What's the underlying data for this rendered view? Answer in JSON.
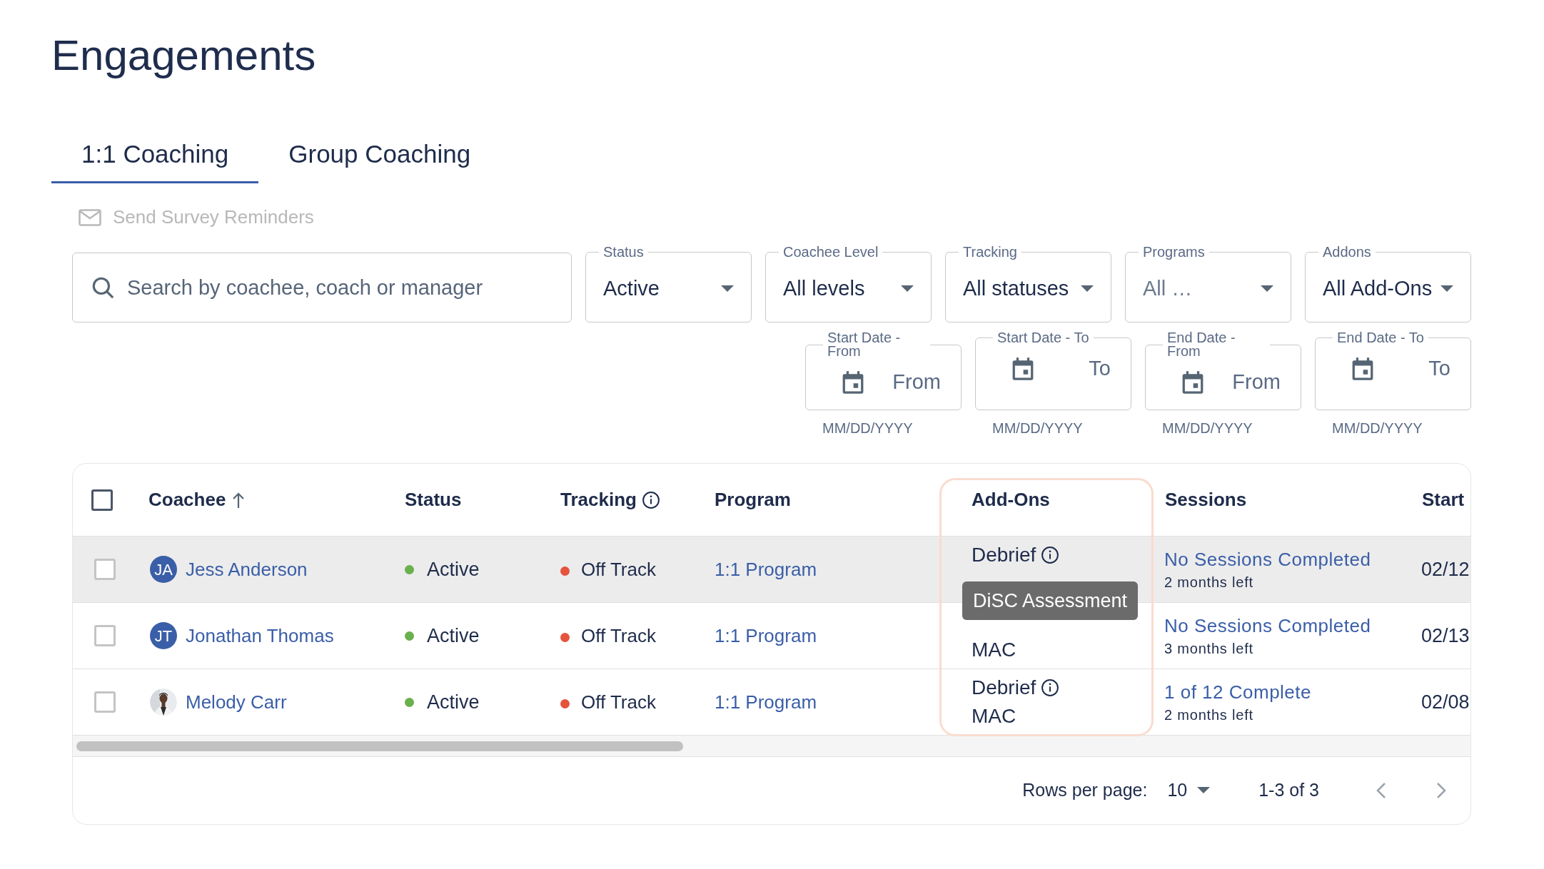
{
  "page": {
    "title": "Engagements"
  },
  "tabs": [
    {
      "label": "1:1 Coaching",
      "selected": true
    },
    {
      "label": "Group Coaching",
      "selected": false
    }
  ],
  "send_reminders": {
    "label": "Send Survey Reminders",
    "disabled": true
  },
  "search": {
    "placeholder": "Search by coachee, coach or manager"
  },
  "filters": [
    {
      "label": "Status",
      "value": "Active"
    },
    {
      "label": "Coachee Level",
      "value": "All levels"
    },
    {
      "label": "Tracking",
      "value": "All statuses"
    },
    {
      "label": "Programs",
      "placeholder": "All …"
    },
    {
      "label": "Addons",
      "value": "All Add-Ons"
    }
  ],
  "date_filters": [
    {
      "label": "Start Date - From",
      "placeholder": "From",
      "hint": "MM/DD/YYYY"
    },
    {
      "label": "Start Date - To",
      "placeholder": "To",
      "hint": "MM/DD/YYYY"
    },
    {
      "label": "End Date - From",
      "placeholder": "From",
      "hint": "MM/DD/YYYY"
    },
    {
      "label": "End Date - To",
      "placeholder": "To",
      "hint": "MM/DD/YYYY"
    }
  ],
  "table": {
    "select_all": {
      "checked": false
    },
    "columns": [
      {
        "label": "Coachee",
        "sorted_ascending": true
      },
      {
        "label": "Status"
      },
      {
        "label": "Tracking",
        "info": true
      },
      {
        "label": "Program"
      },
      {
        "label": "Add-Ons",
        "highlighted": true
      },
      {
        "label": "Sessions"
      },
      {
        "label": "Start"
      }
    ],
    "rows": [
      {
        "checked": false,
        "hovered": true,
        "avatar": {
          "kind": "initials",
          "text": "JA"
        },
        "coachee": "Jess Anderson",
        "status": {
          "label": "Active",
          "color": "#6ab04c"
        },
        "tracking": {
          "label": "Off Track",
          "color": "#e5533d"
        },
        "program": "1:1 Program",
        "addons": [
          {
            "label": "Debrief",
            "info": true
          }
        ],
        "sessions": {
          "summary": "No Sessions Completed",
          "remaining": "2 months left"
        },
        "start_date": "02/12"
      },
      {
        "checked": false,
        "hovered": false,
        "avatar": {
          "kind": "initials",
          "text": "JT"
        },
        "coachee": "Jonathan Thomas",
        "status": {
          "label": "Active",
          "color": "#6ab04c"
        },
        "tracking": {
          "label": "Off Track",
          "color": "#e5533d"
        },
        "program": "1:1 Program",
        "addons": [
          {
            "label": "MAC",
            "second_line": true
          }
        ],
        "sessions": {
          "summary": "No Sessions Completed",
          "remaining": "3 months left"
        },
        "start_date": "02/13"
      },
      {
        "checked": false,
        "hovered": false,
        "avatar": {
          "kind": "picture"
        },
        "coachee": "Melody Carr",
        "status": {
          "label": "Active",
          "color": "#6ab04c"
        },
        "tracking": {
          "label": "Off Track",
          "color": "#e5533d"
        },
        "program": "1:1 Program",
        "addons": [
          {
            "label": "Debrief",
            "info": true
          },
          {
            "label": "MAC",
            "second_line": true
          }
        ],
        "sessions": {
          "summary": "1 of 12 Complete",
          "remaining": "2 months left"
        },
        "start_date": "02/08"
      }
    ],
    "tooltip": {
      "text": "DiSC Assessment"
    }
  },
  "pagination": {
    "rows_per_page_label": "Rows per page:",
    "rows_per_page": "10",
    "range": "1-3 of 3"
  }
}
